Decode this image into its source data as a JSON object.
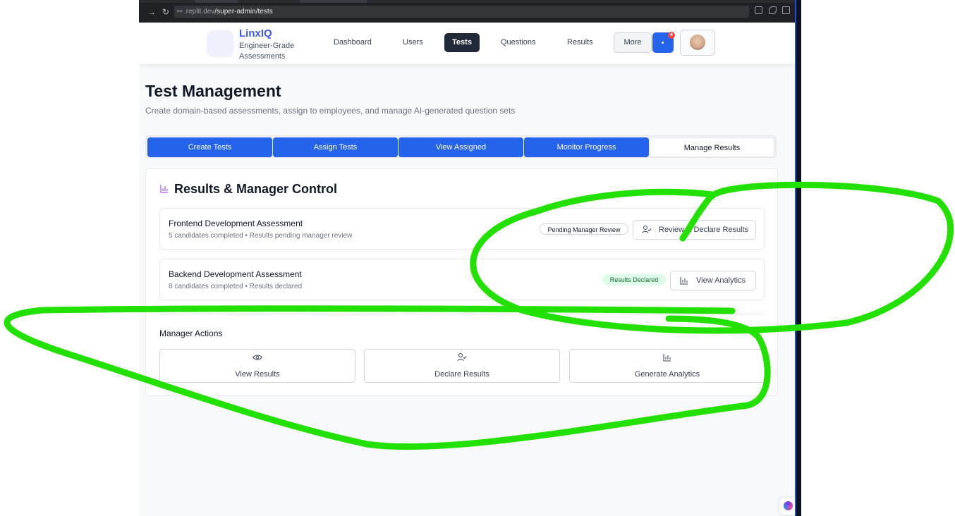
{
  "browser": {
    "url_domain": ".replit.dev",
    "url_path": "/super-admin/tests"
  },
  "header": {
    "brand": "LinxIQ",
    "brand_sub": "Engineer-Grade Assessments",
    "nav": [
      "Dashboard",
      "Users",
      "Tests",
      "Questions",
      "Results"
    ],
    "more": "More",
    "notification_count": "4"
  },
  "page": {
    "title": "Test Management",
    "subtitle": "Create domain-based assessments, assign to employees, and manage AI-generated question sets"
  },
  "tabs": [
    "Create Tests",
    "Assign Tests",
    "View Assigned",
    "Monitor Progress",
    "Manage Results"
  ],
  "card": {
    "title": "Results & Manager Control",
    "rows": [
      {
        "title": "Frontend Development Assessment",
        "subtitle": "5 candidates completed • Results pending manager review",
        "status": "Pending Manager Review",
        "action": "Review & Declare Results"
      },
      {
        "title": "Backend Development Assessment",
        "subtitle": "8 candidates completed • Results declared",
        "status": "Results Declared",
        "action": "View Analytics"
      }
    ],
    "manager_actions_label": "Manager Actions",
    "manager_actions": [
      "View Results",
      "Declare Results",
      "Generate Analytics"
    ]
  },
  "colors": {
    "primary": "#2563eb",
    "brand": "#3b5bdb",
    "annotation": "#22e000"
  }
}
